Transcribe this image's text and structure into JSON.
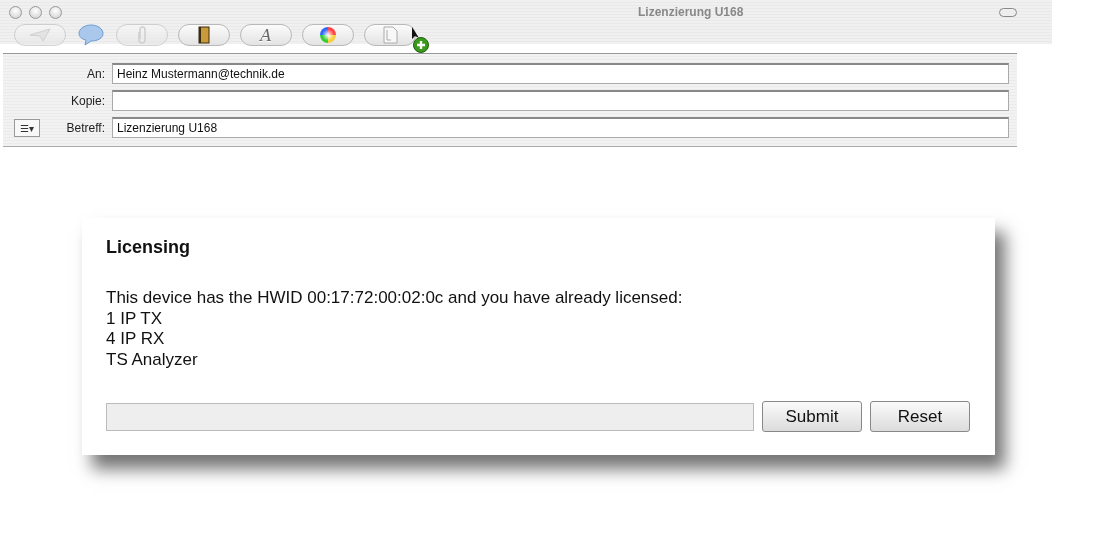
{
  "window": {
    "title": "Lizenzierung U168"
  },
  "toolbar": [
    {
      "kind": "send",
      "disabled": true
    },
    {
      "kind": "chat",
      "disabled": false
    },
    {
      "kind": "attach",
      "disabled": true
    },
    {
      "kind": "addressbook",
      "disabled": false
    },
    {
      "kind": "fonts",
      "label": "A",
      "disabled": false
    },
    {
      "kind": "colors",
      "disabled": false
    },
    {
      "kind": "photos",
      "disabled": false
    }
  ],
  "fields": [
    {
      "label": "An:",
      "value": "Heinz Mustermann@technik.de"
    },
    {
      "label": "Kopie:"
    },
    {
      "label": "Betreff:",
      "value": "Lizenzierung U168",
      "menu_button": "☰▾"
    }
  ],
  "licensing": {
    "title": "Licensing",
    "lines": [
      "This device has the HWID 00:17:72:00:02:0c and you have already licensed:",
      "1 IP TX",
      "4 IP RX",
      "TS Analyzer"
    ],
    "buttons": [
      "Submit",
      "Reset"
    ]
  }
}
